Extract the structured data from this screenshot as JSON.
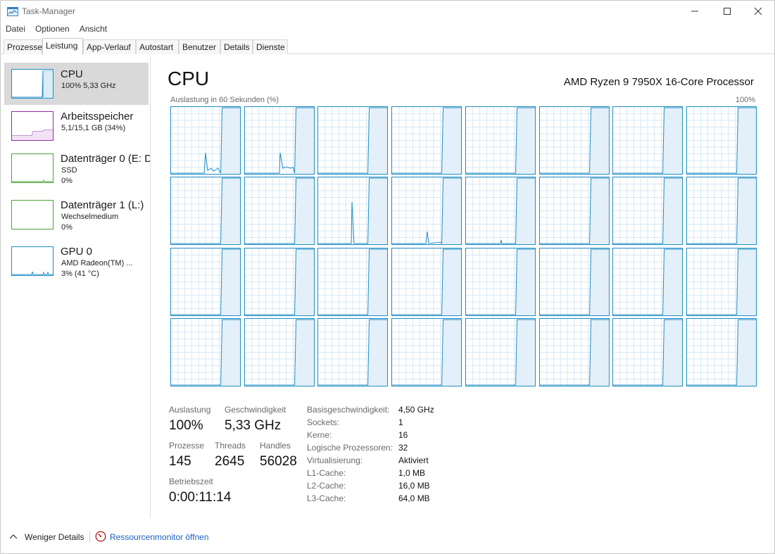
{
  "window": {
    "title": "Task-Manager"
  },
  "menu": [
    "Datei",
    "Optionen",
    "Ansicht"
  ],
  "tabs": [
    "Prozesse",
    "Leistung",
    "App-Verlauf",
    "Autostart",
    "Benutzer",
    "Details",
    "Dienste"
  ],
  "active_tab": "Leistung",
  "sidebar": [
    {
      "title": "CPU",
      "line1": "100%  5,33 GHz",
      "line2": "",
      "color": "#1f8dc6"
    },
    {
      "title": "Arbeitsspeicher",
      "line1": "5,1/15,1 GB (34%)",
      "line2": "",
      "color": "#8b2fa0"
    },
    {
      "title": "Datenträger 0 (E: D",
      "line1": "SSD",
      "line2": "0%",
      "color": "#4da33a"
    },
    {
      "title": "Datenträger 1 (L:)",
      "line1": "Wechselmedium",
      "line2": "0%",
      "color": "#4da33a"
    },
    {
      "title": "GPU 0",
      "line1": "AMD Radeon(TM) ...",
      "line2": "3% (41 °C)",
      "color": "#1f8dc6"
    }
  ],
  "main": {
    "title": "CPU",
    "processor": "AMD Ryzen 9 7950X 16-Core Processor",
    "graph_caption": "Auslastung in 60 Sekunden (%)",
    "graph_max": "100%",
    "logical_processor_count": 32,
    "line_color": "#1f8dc6"
  },
  "stats": {
    "auslastung_label": "Auslastung",
    "auslastung_value": "100%",
    "geschwindigkeit_label": "Geschwindigkeit",
    "geschwindigkeit_value": "5,33 GHz",
    "prozesse_label": "Prozesse",
    "prozesse_value": "145",
    "threads_label": "Threads",
    "threads_value": "2645",
    "handles_label": "Handles",
    "handles_value": "56028",
    "betriebszeit_label": "Betriebszeit",
    "betriebszeit_value": "0:00:11:14"
  },
  "details": [
    {
      "key": "Basisgeschwindigkeit:",
      "value": "4,50 GHz"
    },
    {
      "key": "Sockets:",
      "value": "1"
    },
    {
      "key": "Kerne:",
      "value": "16"
    },
    {
      "key": "Logische Prozessoren:",
      "value": "32"
    },
    {
      "key": "Virtualisierung:",
      "value": "Aktiviert"
    },
    {
      "key": "L1-Cache:",
      "value": "1,0 MB"
    },
    {
      "key": "L2-Cache:",
      "value": "16,0 MB"
    },
    {
      "key": "L3-Cache:",
      "value": "64,0 MB"
    }
  ],
  "footer": {
    "less_details": "Weniger Details",
    "resource_monitor": "Ressourcenmonitor öffnen"
  }
}
